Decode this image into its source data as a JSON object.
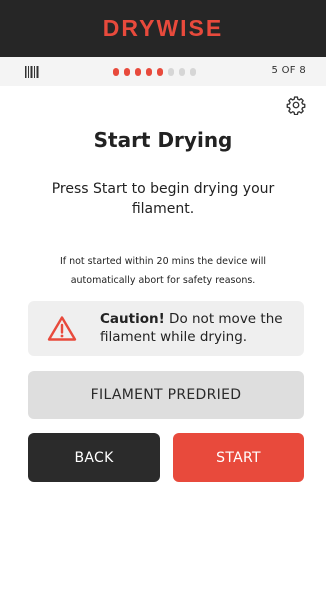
{
  "header": {
    "brand": "DRYWISE"
  },
  "progress": {
    "icon": "barcode-icon",
    "completed_steps": 5,
    "total_steps": 8,
    "step_label": "5 OF 8"
  },
  "settings": {
    "icon": "gear-icon"
  },
  "main": {
    "title": "Start Drying",
    "instruction": "Press Start to begin drying your filament.",
    "note": "If not started within 20 mins the device will automatically abort for safety reasons."
  },
  "caution": {
    "icon": "warning-triangle-icon",
    "label": "Caution!",
    "text": " Do not move the filament while drying."
  },
  "buttons": {
    "predried": "FILAMENT PREDRIED",
    "back": "BACK",
    "start": "START"
  },
  "colors": {
    "accent": "#e84a3c",
    "dark": "#2b2b2b",
    "light": "#efefef"
  }
}
